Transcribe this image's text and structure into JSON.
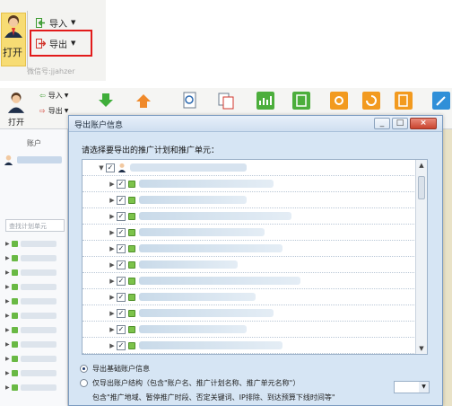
{
  "zoom_panel": {
    "open_label": "打开",
    "import_label": "导入",
    "export_label": "导出",
    "watermark": "微信号:jjahzer",
    "highlight_color": "#e21b1b"
  },
  "toolbar": {
    "open_label": "打开",
    "import_label": "导入",
    "export_label": "导出",
    "icons": [
      "download-icon",
      "upload-icon",
      "search-doc-icon",
      "copy-doc-icon",
      "chart-icon",
      "report-icon",
      "settings-icon",
      "refresh-icon",
      "edit-doc-icon",
      "edit-icon"
    ]
  },
  "sidebar": {
    "account_title": "账户",
    "search_placeholder": "查找计划单元"
  },
  "dialog": {
    "title": "导出账户信息",
    "minimize": "_",
    "maximize": "□",
    "close": "×",
    "prompt": "请选择要导出的推广计划和推广单元：",
    "check_mark": "✓",
    "options": [
      {
        "label": "导出基础账户信息",
        "selected": true
      },
      {
        "label": "仅导出账户结构（包含\"账户名、推广计划名称、推广单元名称\"）",
        "selected": false
      }
    ],
    "sub_note": "包含\"推广地域、暂停推广时段、否定关键词、IP排除、到达预算下线时间等\""
  }
}
